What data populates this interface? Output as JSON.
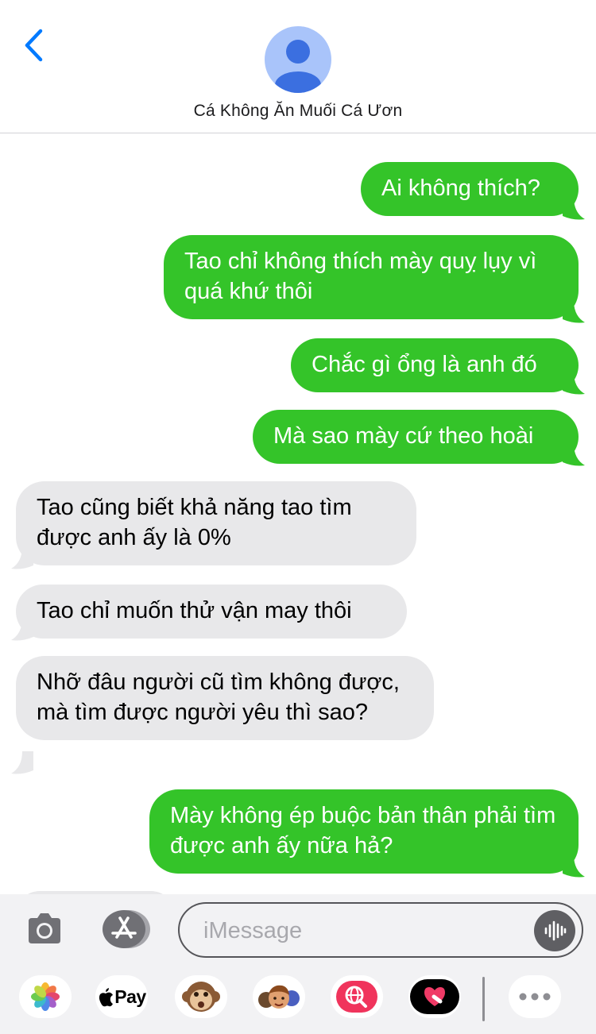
{
  "header": {
    "back_icon": "chevron-left-icon",
    "avatar_icon": "person-icon",
    "contact_name": "Cá Không Ăn Muối Cá Ươn"
  },
  "colors": {
    "outgoing": "#34c429",
    "incoming": "#e8e8ea",
    "accent": "#007aff"
  },
  "messages": [
    {
      "from": "me",
      "text": "Ai không thích?"
    },
    {
      "from": "me",
      "text": "Tao chỉ không thích mày quỵ lụy vì quá khứ thôi"
    },
    {
      "from": "me",
      "text": "Chắc gì ổng là anh đó"
    },
    {
      "from": "me",
      "text": "Mà sao mày cứ theo hoài"
    },
    {
      "from": "them",
      "text": "Tao cũng biết khả năng tao tìm được anh ấy là 0%"
    },
    {
      "from": "them",
      "text": "Tao chỉ muốn thử vận may thôi"
    },
    {
      "from": "them",
      "text": "Nhỡ đâu người cũ tìm không được, mà tìm được người yêu thì sao?"
    },
    {
      "from": "me",
      "text": "Mày không ép buộc bản thân phải tìm được anh ấy nữa hả?"
    }
  ],
  "composer": {
    "camera_icon": "camera-icon",
    "apps_icon": "app-store-icon",
    "placeholder": "iMessage",
    "audio_icon": "waveform-icon"
  },
  "app_drawer": {
    "items": [
      {
        "name": "photos",
        "icon": "photos-icon"
      },
      {
        "name": "apple-pay",
        "label": "Pay",
        "icon": "apple-logo-icon"
      },
      {
        "name": "animoji",
        "icon": "monkey-icon"
      },
      {
        "name": "memoji",
        "icon": "memoji-icon"
      },
      {
        "name": "images-search",
        "icon": "globe-search-icon"
      },
      {
        "name": "digital-touch",
        "icon": "heart-touch-icon"
      },
      {
        "name": "more",
        "icon": "more-icon"
      }
    ]
  }
}
